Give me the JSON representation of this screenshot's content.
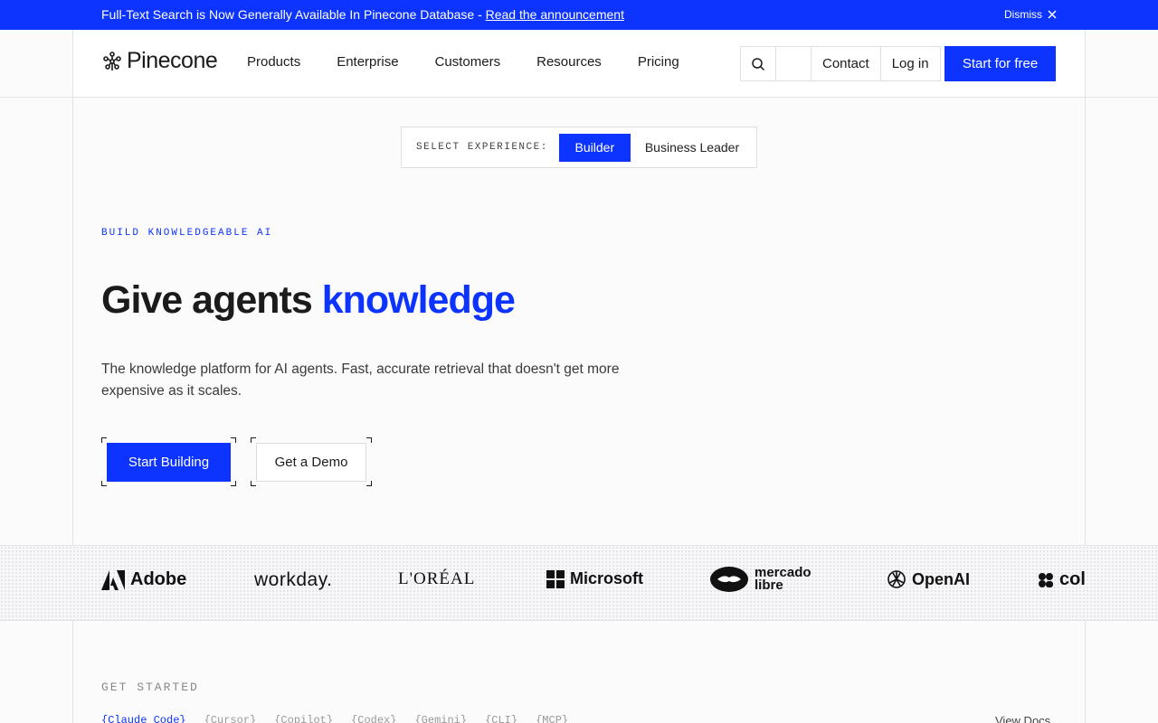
{
  "announcement": {
    "text": "Full-Text Search is Now Generally Available In Pinecone Database - ",
    "link": "Read the announcement",
    "dismiss": "Dismiss"
  },
  "header": {
    "brand": "Pinecone",
    "nav": [
      "Products",
      "Enterprise",
      "Customers",
      "Resources",
      "Pricing"
    ],
    "contact": "Contact",
    "login": "Log in",
    "cta": "Start for free"
  },
  "experience": {
    "label": "SELECT EXPERIENCE:",
    "options": [
      "Builder",
      "Business Leader"
    ],
    "selected": "Builder"
  },
  "hero": {
    "eyebrow": "BUILD KNOWLEDGEABLE AI",
    "headline_plain": "Give agents ",
    "headline_accent": "knowledge",
    "subtext": "The knowledge platform for AI agents. Fast, accurate retrieval that doesn't get more expensive as it scales.",
    "primary_cta": "Start Building",
    "secondary_cta": "Get a Demo"
  },
  "logos": {
    "adobe": "Adobe",
    "workday": "workday.",
    "loreal": "L'ORÉAL",
    "microsoft": "Microsoft",
    "mercado_line1": "mercado",
    "mercado_line2": "libre",
    "openai": "OpenAI",
    "cohere": "col"
  },
  "get_started": {
    "label": "GET STARTED",
    "tabs": [
      "{Claude Code}",
      "{Cursor}",
      "{Copilot}",
      "{Codex}",
      "{Gemini}",
      "{CLI}",
      "{MCP}"
    ],
    "active_tab": "{Claude Code}",
    "view_docs": "View Docs"
  },
  "colors": {
    "brand_blue": "#0d33ff",
    "text_dark": "#1b1b1b",
    "background": "#fbfbfc"
  }
}
